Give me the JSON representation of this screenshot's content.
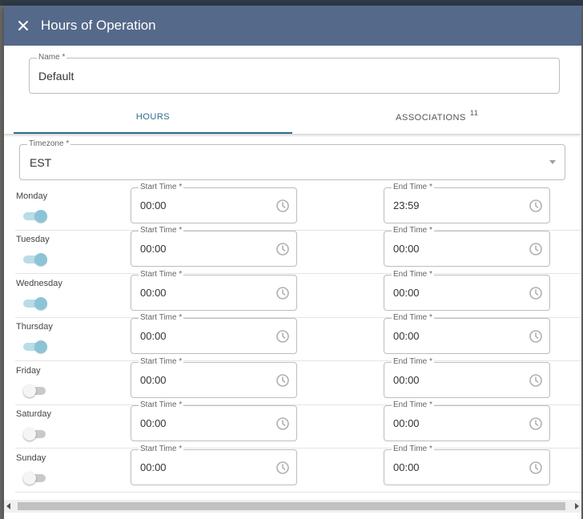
{
  "dialog": {
    "title": "Hours of Operation"
  },
  "name_field": {
    "label": "Name *",
    "value": "Default"
  },
  "tabs": [
    {
      "label": "HOURS",
      "active": true
    },
    {
      "label": "ASSOCIATIONS",
      "badge": "11",
      "active": false
    }
  ],
  "timezone": {
    "label": "Timezone *",
    "value": "EST"
  },
  "time_labels": {
    "start": "Start Time *",
    "end": "End Time *"
  },
  "days": [
    {
      "name": "Monday",
      "enabled": true,
      "start": "00:00",
      "end": "23:59"
    },
    {
      "name": "Tuesday",
      "enabled": true,
      "start": "00:00",
      "end": "00:00"
    },
    {
      "name": "Wednesday",
      "enabled": true,
      "start": "00:00",
      "end": "00:00"
    },
    {
      "name": "Thursday",
      "enabled": true,
      "start": "00:00",
      "end": "00:00"
    },
    {
      "name": "Friday",
      "enabled": false,
      "start": "00:00",
      "end": "00:00"
    },
    {
      "name": "Saturday",
      "enabled": false,
      "start": "00:00",
      "end": "00:00"
    },
    {
      "name": "Sunday",
      "enabled": false,
      "start": "00:00",
      "end": "00:00"
    }
  ],
  "colors": {
    "header": "#55698a",
    "accent": "#2c6e8f",
    "toggle_on": "#8cc4d7"
  },
  "icons": {
    "close": "close-icon",
    "clock": "clock-icon",
    "dropdown": "chevron-down-icon"
  }
}
